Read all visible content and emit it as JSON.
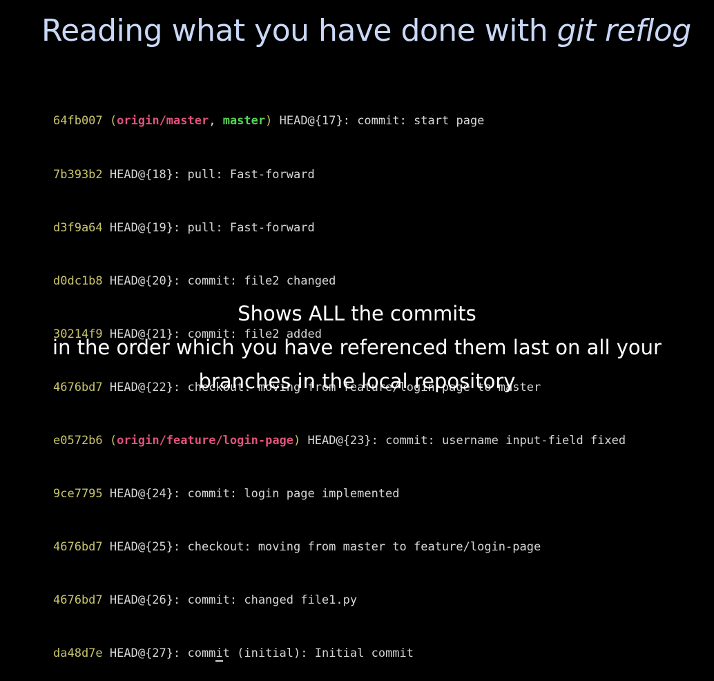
{
  "slide": {
    "title_prefix": "Reading what you have done with ",
    "title_command": "git reflog"
  },
  "terminal": {
    "lines": [
      {
        "hash": "64fb007",
        "refs": [
          {
            "name": "origin/master",
            "kind": "remote"
          },
          {
            "name": "master",
            "kind": "local"
          }
        ],
        "text": " HEAD@{17}: commit: start page"
      },
      {
        "hash": "7b393b2",
        "refs": [],
        "text": " HEAD@{18}: pull: Fast-forward"
      },
      {
        "hash": "d3f9a64",
        "refs": [],
        "text": " HEAD@{19}: pull: Fast-forward"
      },
      {
        "hash": "d0dc1b8",
        "refs": [],
        "text": " HEAD@{20}: commit: file2 changed"
      },
      {
        "hash": "30214f9",
        "refs": [],
        "text": " HEAD@{21}: commit: file2 added"
      },
      {
        "hash": "4676bd7",
        "refs": [],
        "text": " HEAD@{22}: checkout: moving from feature/login-page to master"
      },
      {
        "hash": "e0572b6",
        "refs": [
          {
            "name": "origin/feature/login-page",
            "kind": "remote"
          }
        ],
        "text": " HEAD@{23}: commit: username input-field fixed"
      },
      {
        "hash": "9ce7795",
        "refs": [],
        "text": " HEAD@{24}: commit: login page implemented"
      },
      {
        "hash": "4676bd7",
        "refs": [],
        "text": " HEAD@{25}: checkout: moving from master to feature/login-page"
      },
      {
        "hash": "4676bd7",
        "refs": [],
        "text": " HEAD@{26}: commit: changed file1.py"
      },
      {
        "hash": "da48d7e",
        "refs": [],
        "text_before_caret": " HEAD@{27}: comm",
        "caret_char": "i",
        "text_after_caret": "t (initial): Initial commit"
      }
    ],
    "colors": {
      "hash": "#c9c56b",
      "remote_ref": "#e0527c",
      "local_ref": "#56d456",
      "text": "#d6d6d6"
    }
  },
  "caption": {
    "line1": "Shows ALL the commits",
    "line2": "in the order which you have referenced them last on all your",
    "line3": "branches in the local repository"
  }
}
